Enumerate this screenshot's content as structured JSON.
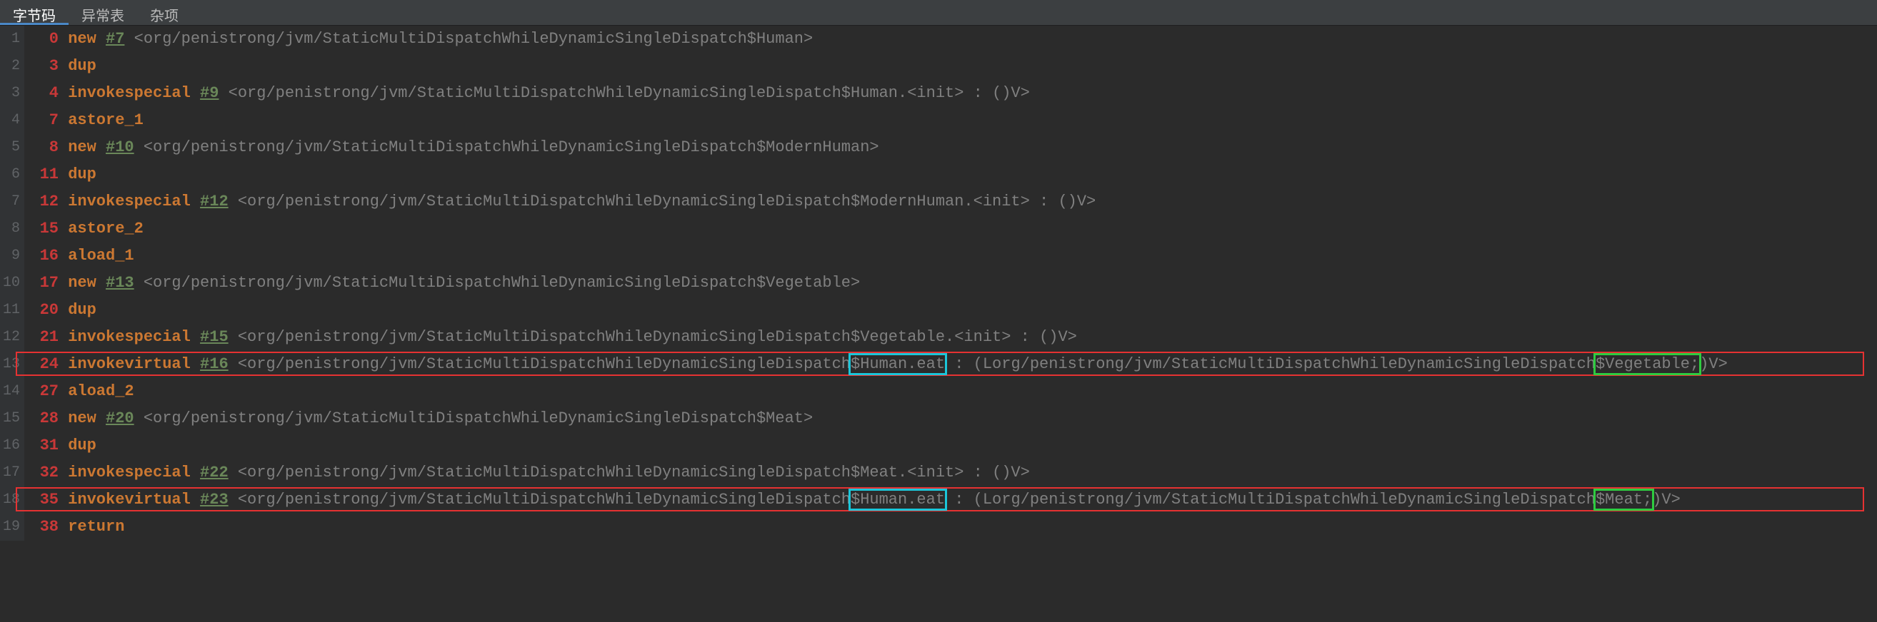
{
  "tabs": {
    "t0": "字节码",
    "t1": "异常表",
    "t2": "杂项"
  },
  "gutter": {
    "g1": "1",
    "g2": "2",
    "g3": "3",
    "g4": "4",
    "g5": "5",
    "g6": "6",
    "g7": "7",
    "g8": "8",
    "g9": "9",
    "g10": "10",
    "g11": "11",
    "g12": "12",
    "g13": "13",
    "g14": "14",
    "g15": "15",
    "g16": "16",
    "g17": "17",
    "g18": "18",
    "g19": "19"
  },
  "code": {
    "l1": {
      "off": "0",
      "op": "new",
      "ref": "#7",
      "cmt": "<org/penistrong/jvm/StaticMultiDispatchWhileDynamicSingleDispatch$Human>"
    },
    "l2": {
      "off": "3",
      "op": "dup"
    },
    "l3": {
      "off": "4",
      "op": "invokespecial",
      "ref": "#9",
      "cmt": "<org/penistrong/jvm/StaticMultiDispatchWhileDynamicSingleDispatch$Human.<init> : ()V>"
    },
    "l4": {
      "off": "7",
      "op": "astore_1"
    },
    "l5": {
      "off": "8",
      "op": "new",
      "ref": "#10",
      "cmt": "<org/penistrong/jvm/StaticMultiDispatchWhileDynamicSingleDispatch$ModernHuman>"
    },
    "l6": {
      "off": "11",
      "op": "dup"
    },
    "l7": {
      "off": "12",
      "op": "invokespecial",
      "ref": "#12",
      "cmt": "<org/penistrong/jvm/StaticMultiDispatchWhileDynamicSingleDispatch$ModernHuman.<init> : ()V>"
    },
    "l8": {
      "off": "15",
      "op": "astore_2"
    },
    "l9": {
      "off": "16",
      "op": "aload_1"
    },
    "l10": {
      "off": "17",
      "op": "new",
      "ref": "#13",
      "cmt": "<org/penistrong/jvm/StaticMultiDispatchWhileDynamicSingleDispatch$Vegetable>"
    },
    "l11": {
      "off": "20",
      "op": "dup"
    },
    "l12": {
      "off": "21",
      "op": "invokespecial",
      "ref": "#15",
      "cmt": "<org/penistrong/jvm/StaticMultiDispatchWhileDynamicSingleDispatch$Vegetable.<init> : ()V>"
    },
    "l13": {
      "off": "24",
      "op": "invokevirtual",
      "ref": "#16",
      "cmt1": "<org/penistrong/jvm/StaticMultiDispatchWhileDynamicSingleDispatch",
      "seg1": "$Human.eat",
      "cmt2": " : (Lorg/penistrong/jvm/StaticMultiDispatchWhileDynamicSingleDispatch",
      "seg2": "$Vegetable;",
      "cmt3": ")V>"
    },
    "l14": {
      "off": "27",
      "op": "aload_2"
    },
    "l15": {
      "off": "28",
      "op": "new",
      "ref": "#20",
      "cmt": "<org/penistrong/jvm/StaticMultiDispatchWhileDynamicSingleDispatch$Meat>"
    },
    "l16": {
      "off": "31",
      "op": "dup"
    },
    "l17": {
      "off": "32",
      "op": "invokespecial",
      "ref": "#22",
      "cmt": "<org/penistrong/jvm/StaticMultiDispatchWhileDynamicSingleDispatch$Meat.<init> : ()V>"
    },
    "l18": {
      "off": "35",
      "op": "invokevirtual",
      "ref": "#23",
      "cmt1": "<org/penistrong/jvm/StaticMultiDispatchWhileDynamicSingleDispatch",
      "seg1": "$Human.eat",
      "cmt2": " : (Lorg/penistrong/jvm/StaticMultiDispatchWhileDynamicSingleDispatch",
      "seg2": "$Meat;",
      "cmt3": ")V>"
    },
    "l19": {
      "off": "38",
      "op": "return"
    }
  }
}
